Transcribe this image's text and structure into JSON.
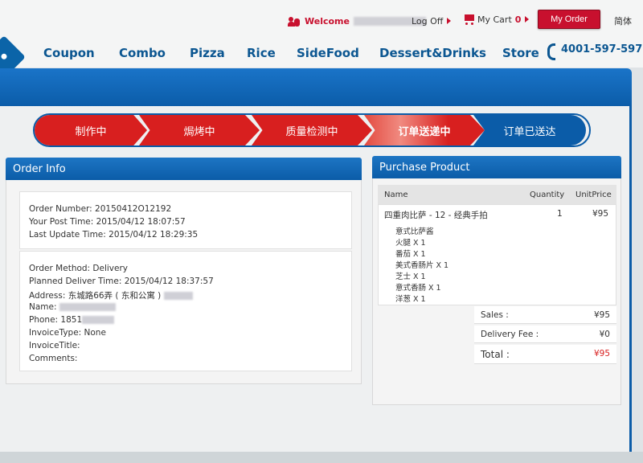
{
  "header": {
    "welcome": "Welcome",
    "log_off": "Log Off",
    "my_cart": "My Cart",
    "cart_count": "0",
    "my_order": "My Order",
    "language": "简体"
  },
  "nav": {
    "items": [
      "Coupon",
      "Combo",
      "Pizza",
      "Rice",
      "SideFood",
      "Dessert&Drinks",
      "Store"
    ],
    "phone": "4001-597-597"
  },
  "progress": {
    "steps": [
      "制作中",
      "焗烤中",
      "质量检测中",
      "订单送递中",
      "订单已送达"
    ],
    "current_step": 4
  },
  "order_info": {
    "title": "Order Info",
    "order_number": "Order Number: 20150412O12192",
    "post_time": "Your Post Time: 2015/04/12 18:07:57",
    "update_time": "Last Update Time: 2015/04/12 18:29:35",
    "method": "Order Method: Delivery",
    "planned": "Planned Deliver Time: 2015/04/12 18:37:57",
    "address": "Address: 东城路66弄 ( 东和公寓 )",
    "name": "Name:",
    "phone": "Phone: 1851",
    "invoice_type": "InvoiceType: None",
    "invoice_title": "InvoiceTitle:",
    "comments": "Comments:"
  },
  "purchase": {
    "title": "Purchase Product",
    "col_name": "Name",
    "col_qty": "Quantity",
    "col_price": "UnitPrice",
    "product": "四重肉比萨 - 12 - 经典手拍",
    "qty": "1",
    "price": "¥95",
    "toppings": [
      "意式比萨酱",
      "火腿 X 1",
      "番茄 X 1",
      "美式香肠片 X 1",
      "芝士 X 1",
      "意式香肠 X 1",
      "洋葱 X 1"
    ],
    "sales_label": "Sales :",
    "sales_value": "¥95",
    "fee_label": "Delivery Fee :",
    "fee_value": "¥0",
    "total_label": "Total :",
    "total_value": "¥95"
  },
  "colors": {
    "brand_red": "#c8102e",
    "brand_blue": "#0b5ca8"
  }
}
